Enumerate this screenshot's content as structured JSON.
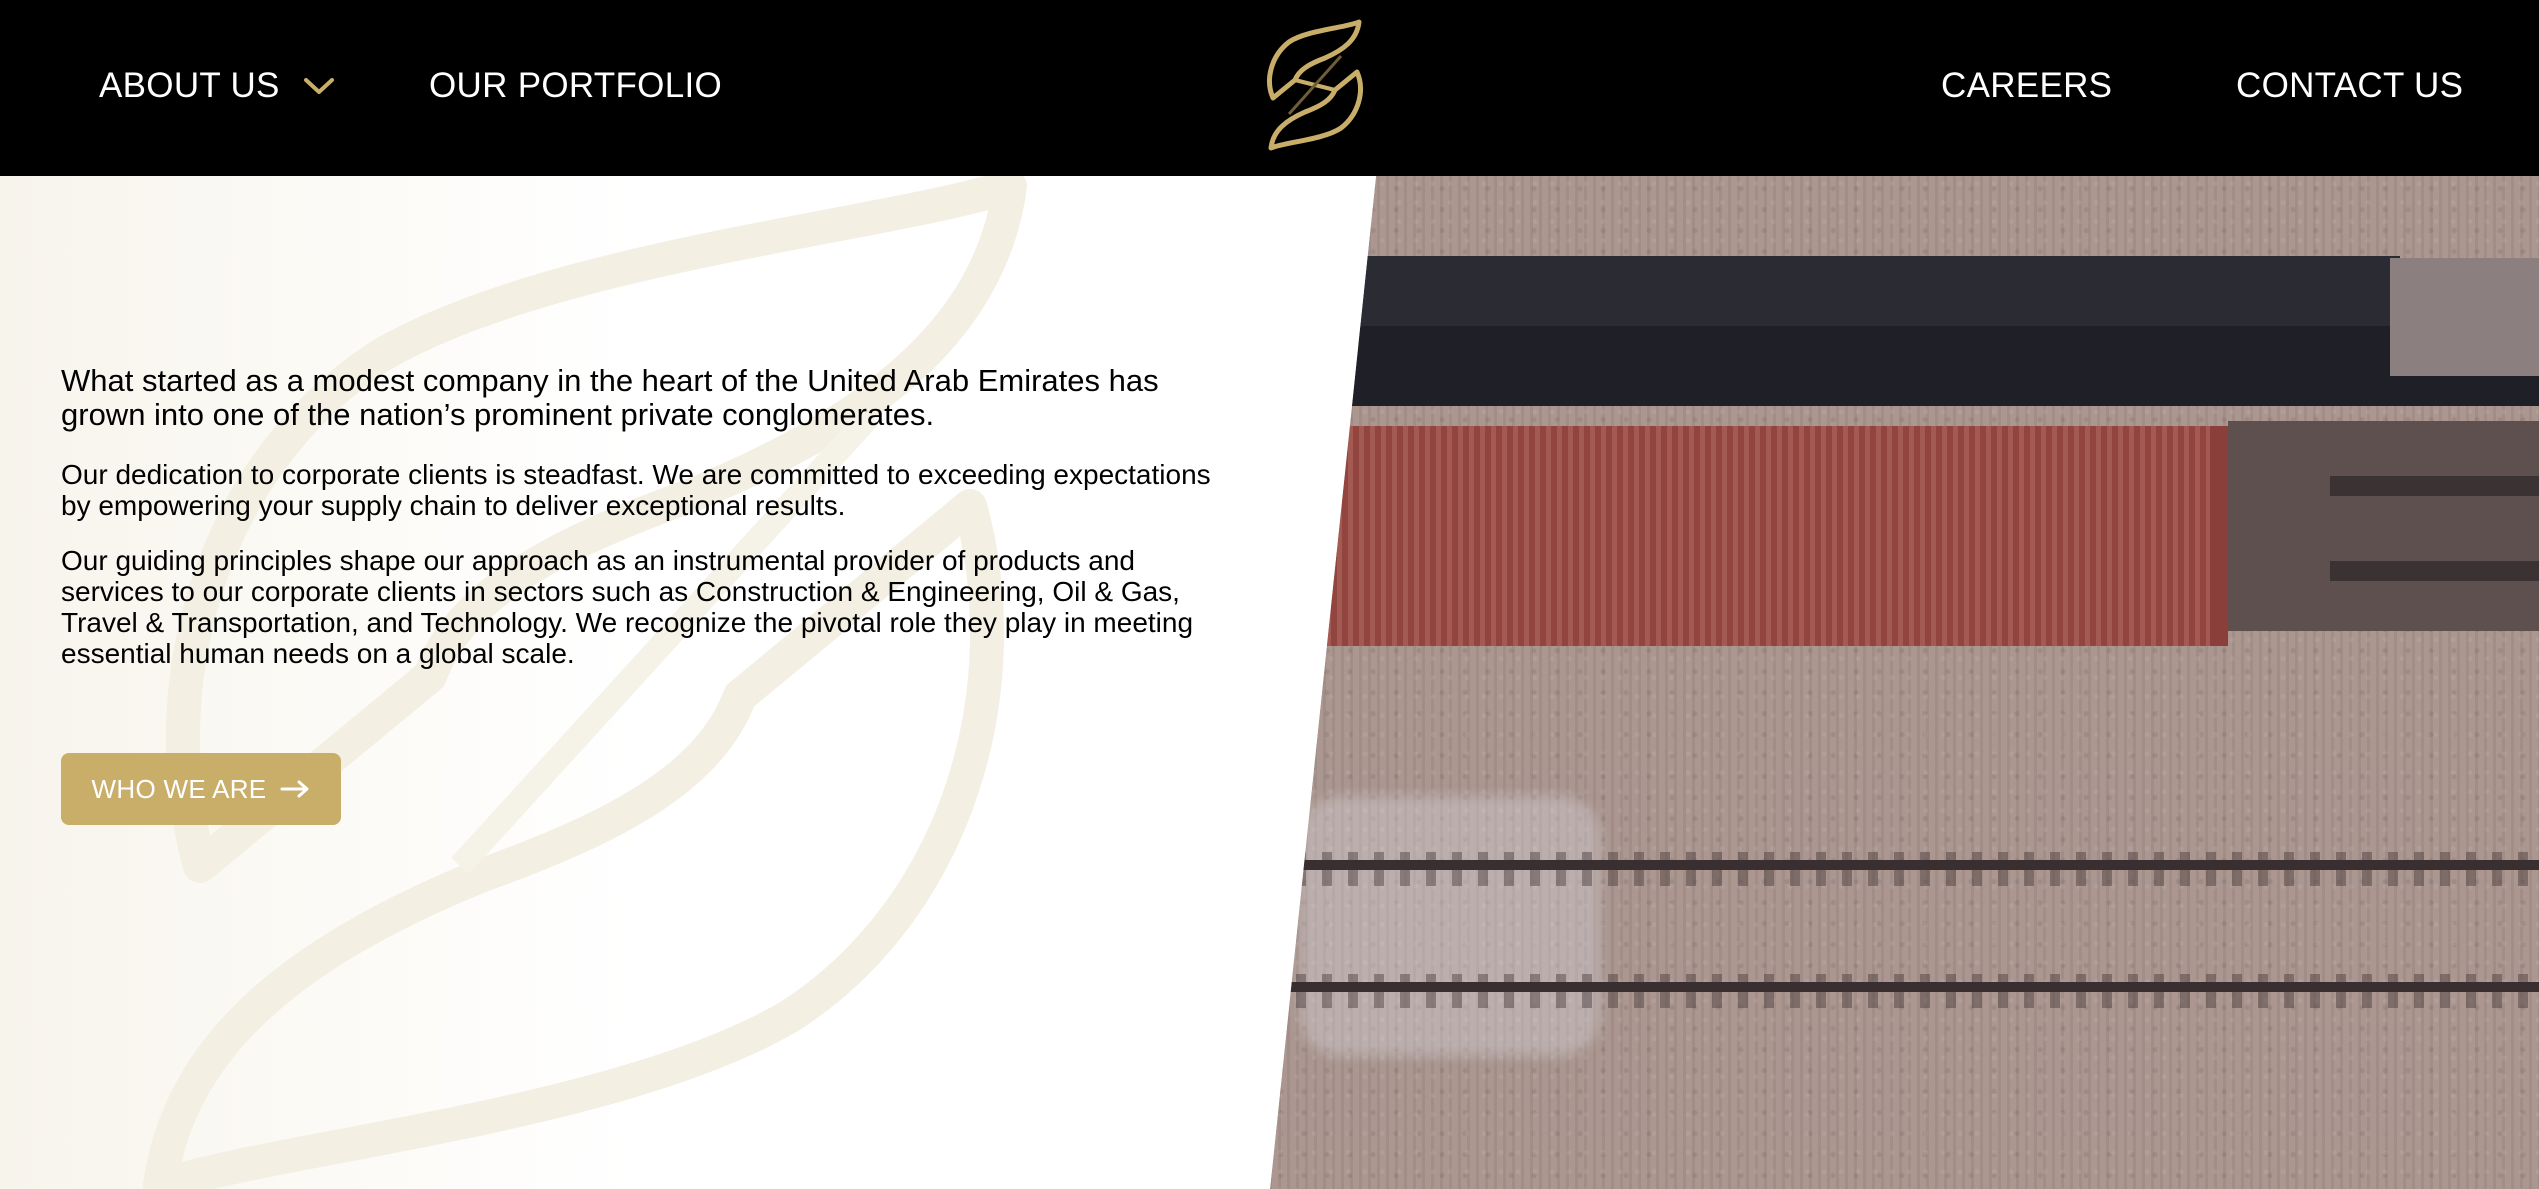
{
  "nav": {
    "about_label": "ABOUT US",
    "portfolio_label": "OUR PORTFOLIO",
    "careers_label": "CAREERS",
    "contact_label": "CONTACT US",
    "about_icon": "chevron-down-icon",
    "logo_icon": "brand-leaf-logo"
  },
  "hero": {
    "lead": "What started as a modest company in the heart of the United Arab Emirates has grown into one of the nation’s prominent private conglomerates.",
    "paragraph_1": "Our dedication to corporate clients is steadfast. We are committed to exceeding expectations by empowering your supply chain to deliver exceptional results.",
    "paragraph_2": "Our guiding principles shape our approach as an instrumental provider of products and services to our corporate clients in sectors such as Construction & Engineering, Oil & Gas, Travel & Transportation, and Technology. We recognize the pivotal role they play in meeting essential human needs on a global scale.",
    "cta_label": "WHO WE ARE",
    "cta_icon": "arrow-right-icon"
  },
  "colors": {
    "header_bg": "#000000",
    "accent_gold": "#c9ae6a",
    "text": "#000000",
    "container_red": "#9a4b44"
  }
}
